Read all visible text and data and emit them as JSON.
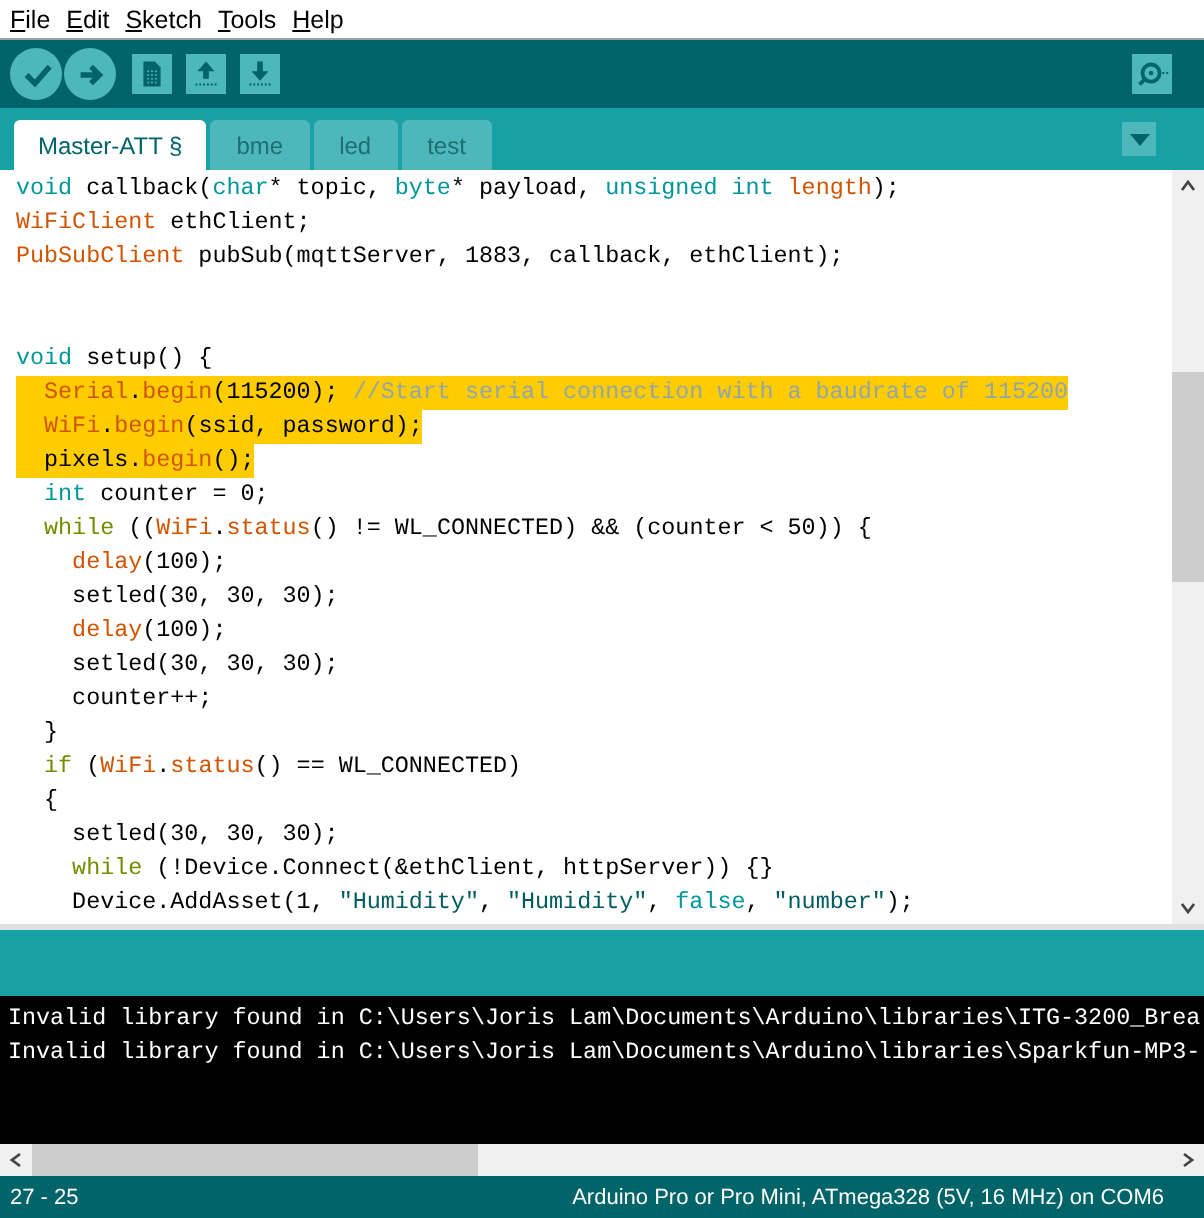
{
  "menu": [
    {
      "label": "File",
      "mnemonic": true
    },
    {
      "label": "Edit",
      "mnemonic": true
    },
    {
      "label": "Sketch",
      "mnemonic": true
    },
    {
      "label": "Tools",
      "mnemonic": true
    },
    {
      "label": "Help",
      "mnemonic": true
    }
  ],
  "toolbar": [
    {
      "kind": "verify"
    },
    {
      "kind": "upload"
    },
    {
      "kind": "new"
    },
    {
      "kind": "open"
    },
    {
      "kind": "save"
    }
  ],
  "tabs": [
    {
      "label": "Master-ATT §",
      "selected": true
    },
    {
      "label": "bme",
      "selected": false
    },
    {
      "label": "led",
      "selected": false
    },
    {
      "label": "test",
      "selected": false
    }
  ],
  "editor": {
    "lines": [
      {
        "kind": "code",
        "highlighted": false,
        "tokens": [
          {
            "kind": "type",
            "text": "void"
          },
          {
            "kind": "plain",
            "text": " callback("
          },
          {
            "kind": "type",
            "text": "char"
          },
          {
            "kind": "plain",
            "text": "* topic, "
          },
          {
            "kind": "type",
            "text": "byte"
          },
          {
            "kind": "plain",
            "text": "* payload, "
          },
          {
            "kind": "type",
            "text": "unsigned int"
          },
          {
            "kind": "func",
            "text": " length"
          },
          {
            "kind": "plain",
            "text": ");"
          }
        ]
      },
      {
        "kind": "code",
        "highlighted": false,
        "tokens": [
          {
            "kind": "func",
            "text": "WiFiClient"
          },
          {
            "kind": "plain",
            "text": " ethClient;"
          }
        ]
      },
      {
        "kind": "code",
        "highlighted": false,
        "tokens": [
          {
            "kind": "func",
            "text": "PubSubClient"
          },
          {
            "kind": "plain",
            "text": " pubSub(mqttServer, 1883, callback, ethClient);"
          }
        ]
      },
      {
        "kind": "blank"
      },
      {
        "kind": "blank"
      },
      {
        "kind": "code",
        "highlighted": false,
        "tokens": [
          {
            "kind": "type",
            "text": "void"
          },
          {
            "kind": "plain",
            "text": " setup() {"
          }
        ]
      },
      {
        "kind": "code",
        "highlighted": true,
        "tokens": [
          {
            "kind": "func",
            "text": "  Serial"
          },
          {
            "kind": "plain",
            "text": "."
          },
          {
            "kind": "func",
            "text": "begin"
          },
          {
            "kind": "plain",
            "text": "(115200); "
          },
          {
            "kind": "comment",
            "text": "//Start serial connection with a baudrate of 115200"
          }
        ]
      },
      {
        "kind": "code",
        "highlighted": true,
        "tokens": [
          {
            "kind": "func",
            "text": "  WiFi"
          },
          {
            "kind": "plain",
            "text": "."
          },
          {
            "kind": "func",
            "text": "begin"
          },
          {
            "kind": "plain",
            "text": "(ssid, password);"
          }
        ]
      },
      {
        "kind": "code",
        "highlighted": true,
        "tokens": [
          {
            "kind": "plain",
            "text": "  pixels."
          },
          {
            "kind": "func",
            "text": "begin"
          },
          {
            "kind": "plain",
            "text": "();"
          }
        ]
      },
      {
        "kind": "code",
        "highlighted": false,
        "tokens": [
          {
            "kind": "type",
            "text": "  int"
          },
          {
            "kind": "plain",
            "text": " counter = 0;"
          }
        ]
      },
      {
        "kind": "code",
        "highlighted": false,
        "tokens": [
          {
            "kind": "control",
            "text": "  while"
          },
          {
            "kind": "plain",
            "text": " (("
          },
          {
            "kind": "func",
            "text": "WiFi"
          },
          {
            "kind": "plain",
            "text": "."
          },
          {
            "kind": "func",
            "text": "status"
          },
          {
            "kind": "plain",
            "text": "() != WL_CONNECTED) && (counter < 50)) {"
          }
        ]
      },
      {
        "kind": "code",
        "highlighted": false,
        "tokens": [
          {
            "kind": "func",
            "text": "    delay"
          },
          {
            "kind": "plain",
            "text": "(100);"
          }
        ]
      },
      {
        "kind": "code",
        "highlighted": false,
        "tokens": [
          {
            "kind": "plain",
            "text": "    setled(30, 30, 30);"
          }
        ]
      },
      {
        "kind": "code",
        "highlighted": false,
        "tokens": [
          {
            "kind": "func",
            "text": "    delay"
          },
          {
            "kind": "plain",
            "text": "(100);"
          }
        ]
      },
      {
        "kind": "code",
        "highlighted": false,
        "tokens": [
          {
            "kind": "plain",
            "text": "    setled(30, 30, 30);"
          }
        ]
      },
      {
        "kind": "code",
        "highlighted": false,
        "tokens": [
          {
            "kind": "plain",
            "text": "    counter++;"
          }
        ]
      },
      {
        "kind": "code",
        "highlighted": false,
        "tokens": [
          {
            "kind": "plain",
            "text": "  }"
          }
        ]
      },
      {
        "kind": "code",
        "highlighted": false,
        "tokens": [
          {
            "kind": "control",
            "text": "  if"
          },
          {
            "kind": "plain",
            "text": " ("
          },
          {
            "kind": "func",
            "text": "WiFi"
          },
          {
            "kind": "plain",
            "text": "."
          },
          {
            "kind": "func",
            "text": "status"
          },
          {
            "kind": "plain",
            "text": "() == WL_CONNECTED)"
          }
        ]
      },
      {
        "kind": "code",
        "highlighted": false,
        "tokens": [
          {
            "kind": "plain",
            "text": "  {"
          }
        ]
      },
      {
        "kind": "code",
        "highlighted": false,
        "tokens": [
          {
            "kind": "plain",
            "text": "    setled(30, 30, 30);"
          }
        ]
      },
      {
        "kind": "code",
        "highlighted": false,
        "tokens": [
          {
            "kind": "control",
            "text": "    while"
          },
          {
            "kind": "plain",
            "text": " (!Device.Connect(&ethClient, httpServer)) {}"
          }
        ]
      },
      {
        "kind": "code",
        "highlighted": false,
        "tokens": [
          {
            "kind": "plain",
            "text": "    Device.AddAsset(1, "
          },
          {
            "kind": "string",
            "text": "\"Humidity\""
          },
          {
            "kind": "plain",
            "text": ", "
          },
          {
            "kind": "string",
            "text": "\"Humidity\""
          },
          {
            "kind": "plain",
            "text": ", "
          },
          {
            "kind": "type",
            "text": "false"
          },
          {
            "kind": "plain",
            "text": ", "
          },
          {
            "kind": "string",
            "text": "\"number\""
          },
          {
            "kind": "plain",
            "text": ");"
          }
        ]
      }
    ]
  },
  "console": {
    "lines": [
      "Invalid library found in C:\\Users\\Joris Lam\\Documents\\Arduino\\libraries\\ITG-3200_Brea",
      "Invalid library found in C:\\Users\\Joris Lam\\Documents\\Arduino\\libraries\\Sparkfun-MP3-"
    ]
  },
  "status_bar": {
    "position": "27 - 25",
    "board": "Arduino Pro or Pro Mini, ATmega328 (5V, 16 MHz) on COM6"
  }
}
